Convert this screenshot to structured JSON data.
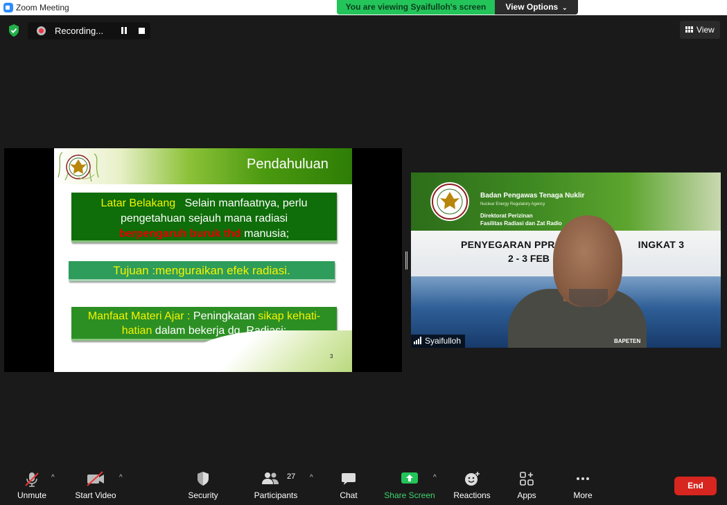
{
  "window": {
    "title": "Zoom Meeting"
  },
  "share_banner": {
    "text": "You are viewing Syaifulloh's screen",
    "view_options": "View Options"
  },
  "recording": {
    "label": "Recording..."
  },
  "view_button": {
    "label": "View"
  },
  "slide": {
    "title": "Pendahuluan",
    "box1": {
      "label": "Latar Belakang",
      "text1": "Selain manfaatnya, perlu pengetahuan sejauh mana radiasi",
      "highlight": "berpengaruh buruk thd",
      "text2": "manusia;"
    },
    "box2": {
      "label": "Tujuan",
      "sep": ":",
      "text": "menguraikan efek radiasi."
    },
    "box3": {
      "label": "Manfaat Materi Ajar",
      "sep": ":",
      "text1": "Peningkatan",
      "highlight1": "sikap kehati-",
      "highlight2": "hatian",
      "text2": "dalam bekerja dg. Radiasi;"
    },
    "page_number": "3"
  },
  "participant_video": {
    "name": "Syaifulloh",
    "banner": {
      "org": "Badan Pengawas Tenaga Nuklir",
      "org_en": "Nuclear Energy Regulatory Agency",
      "dir1": "Direktorat Perizinan",
      "dir2": "Fasilitas Radiasi dan Zat Radio",
      "event_line1": "PENYEGARAN PPR",
      "event_line1_end": "INGKAT 3",
      "event_line2": "2  -  3 FEB",
      "patch": "BAPETEN"
    }
  },
  "toolbar": {
    "unmute": "Unmute",
    "start_video": "Start Video",
    "security": "Security",
    "participants": "Participants",
    "participants_count": "27",
    "chat": "Chat",
    "share_screen": "Share Screen",
    "reactions": "Reactions",
    "apps": "Apps",
    "more": "More",
    "end": "End"
  },
  "colors": {
    "share_green": "#23c45a",
    "end_red": "#d7261f",
    "slide_box_green": "#0f6d0a",
    "slide_yellow": "#f5f400"
  }
}
